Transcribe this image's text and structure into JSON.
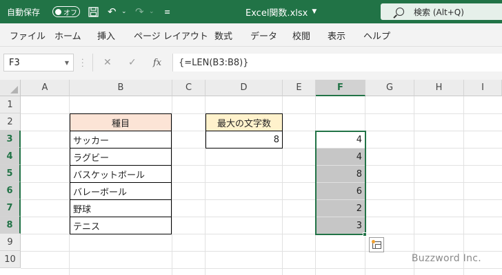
{
  "titlebar": {
    "autosave_label": "自動保存",
    "autosave_toggle": "オフ",
    "filename": "Excel関数.xlsx",
    "search_label": "検索 (Alt+Q)",
    "bg_color": "#217346"
  },
  "menu": [
    "ファイル",
    "ホーム",
    "挿入",
    "ページ レイアウト",
    "数式",
    "データ",
    "校閲",
    "表示",
    "ヘルプ"
  ],
  "formula_bar": {
    "name_box": "F3",
    "fx_label": "fx",
    "formula": "{=LEN(B3:B8)}"
  },
  "grid": {
    "columns": [
      "A",
      "B",
      "C",
      "D",
      "E",
      "F",
      "G",
      "H",
      "I"
    ],
    "rows": [
      "1",
      "2",
      "3",
      "4",
      "5",
      "6",
      "7",
      "8",
      "9",
      "10"
    ],
    "selected_column": "F",
    "selected_rows": [
      "3",
      "4",
      "5",
      "6",
      "7",
      "8"
    ],
    "table_b": {
      "header": "種目",
      "items": [
        "サッカー",
        "ラグビー",
        "バスケットボール",
        "バレーボール",
        "野球",
        "テニス"
      ]
    },
    "table_d": {
      "header": "最大の文字数",
      "value": "8"
    },
    "column_f_values": [
      "4",
      "4",
      "8",
      "6",
      "2",
      "3"
    ]
  },
  "watermark": "Buzzword Inc.",
  "colors": {
    "accent": "#217346",
    "header_orange": "#fce4d6",
    "header_yellow": "#fff2cc",
    "selection_fill": "#c6c6c6"
  }
}
